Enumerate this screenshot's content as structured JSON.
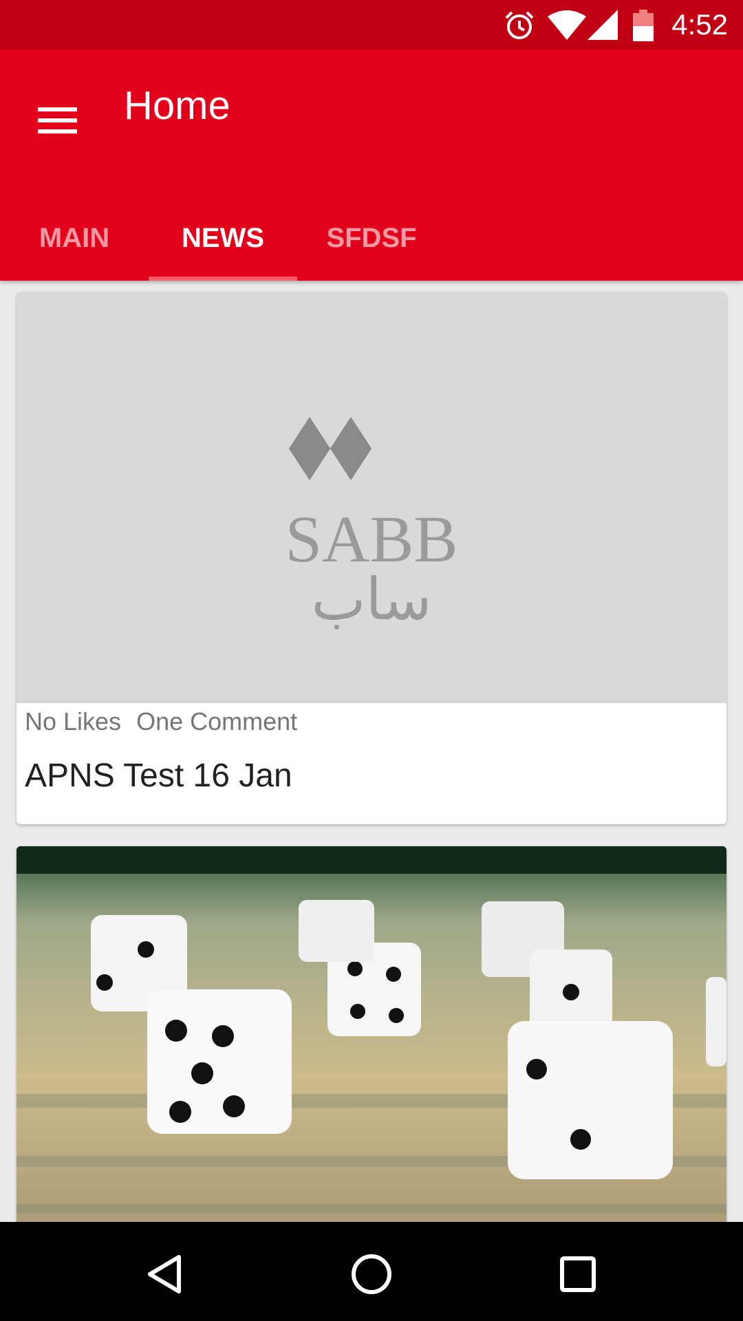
{
  "status_bar": {
    "time": "4:52",
    "icons": [
      "alarm-icon",
      "wifi-icon",
      "signal-icon",
      "battery-icon"
    ]
  },
  "app_bar": {
    "title": "Home",
    "menu_icon": "hamburger-menu-icon"
  },
  "tabs": [
    {
      "label": "MAIN",
      "active": false
    },
    {
      "label": "NEWS",
      "active": true
    },
    {
      "label": "SFDSF",
      "active": false
    }
  ],
  "cards": [
    {
      "image": "sabb-logo-placeholder",
      "logo_text": "SABB",
      "logo_arabic": "ساب",
      "likes": "No Likes",
      "comments": "One Comment",
      "title": "APNS Test 16 Jan"
    },
    {
      "image": "dice-on-money-photo"
    }
  ],
  "nav_bar": {
    "icons": [
      "back-icon",
      "home-icon",
      "recents-icon"
    ]
  },
  "colors": {
    "primary": "#e2001a",
    "status_bar": "#c00012",
    "tab_indicator": "#ff5a6a"
  }
}
